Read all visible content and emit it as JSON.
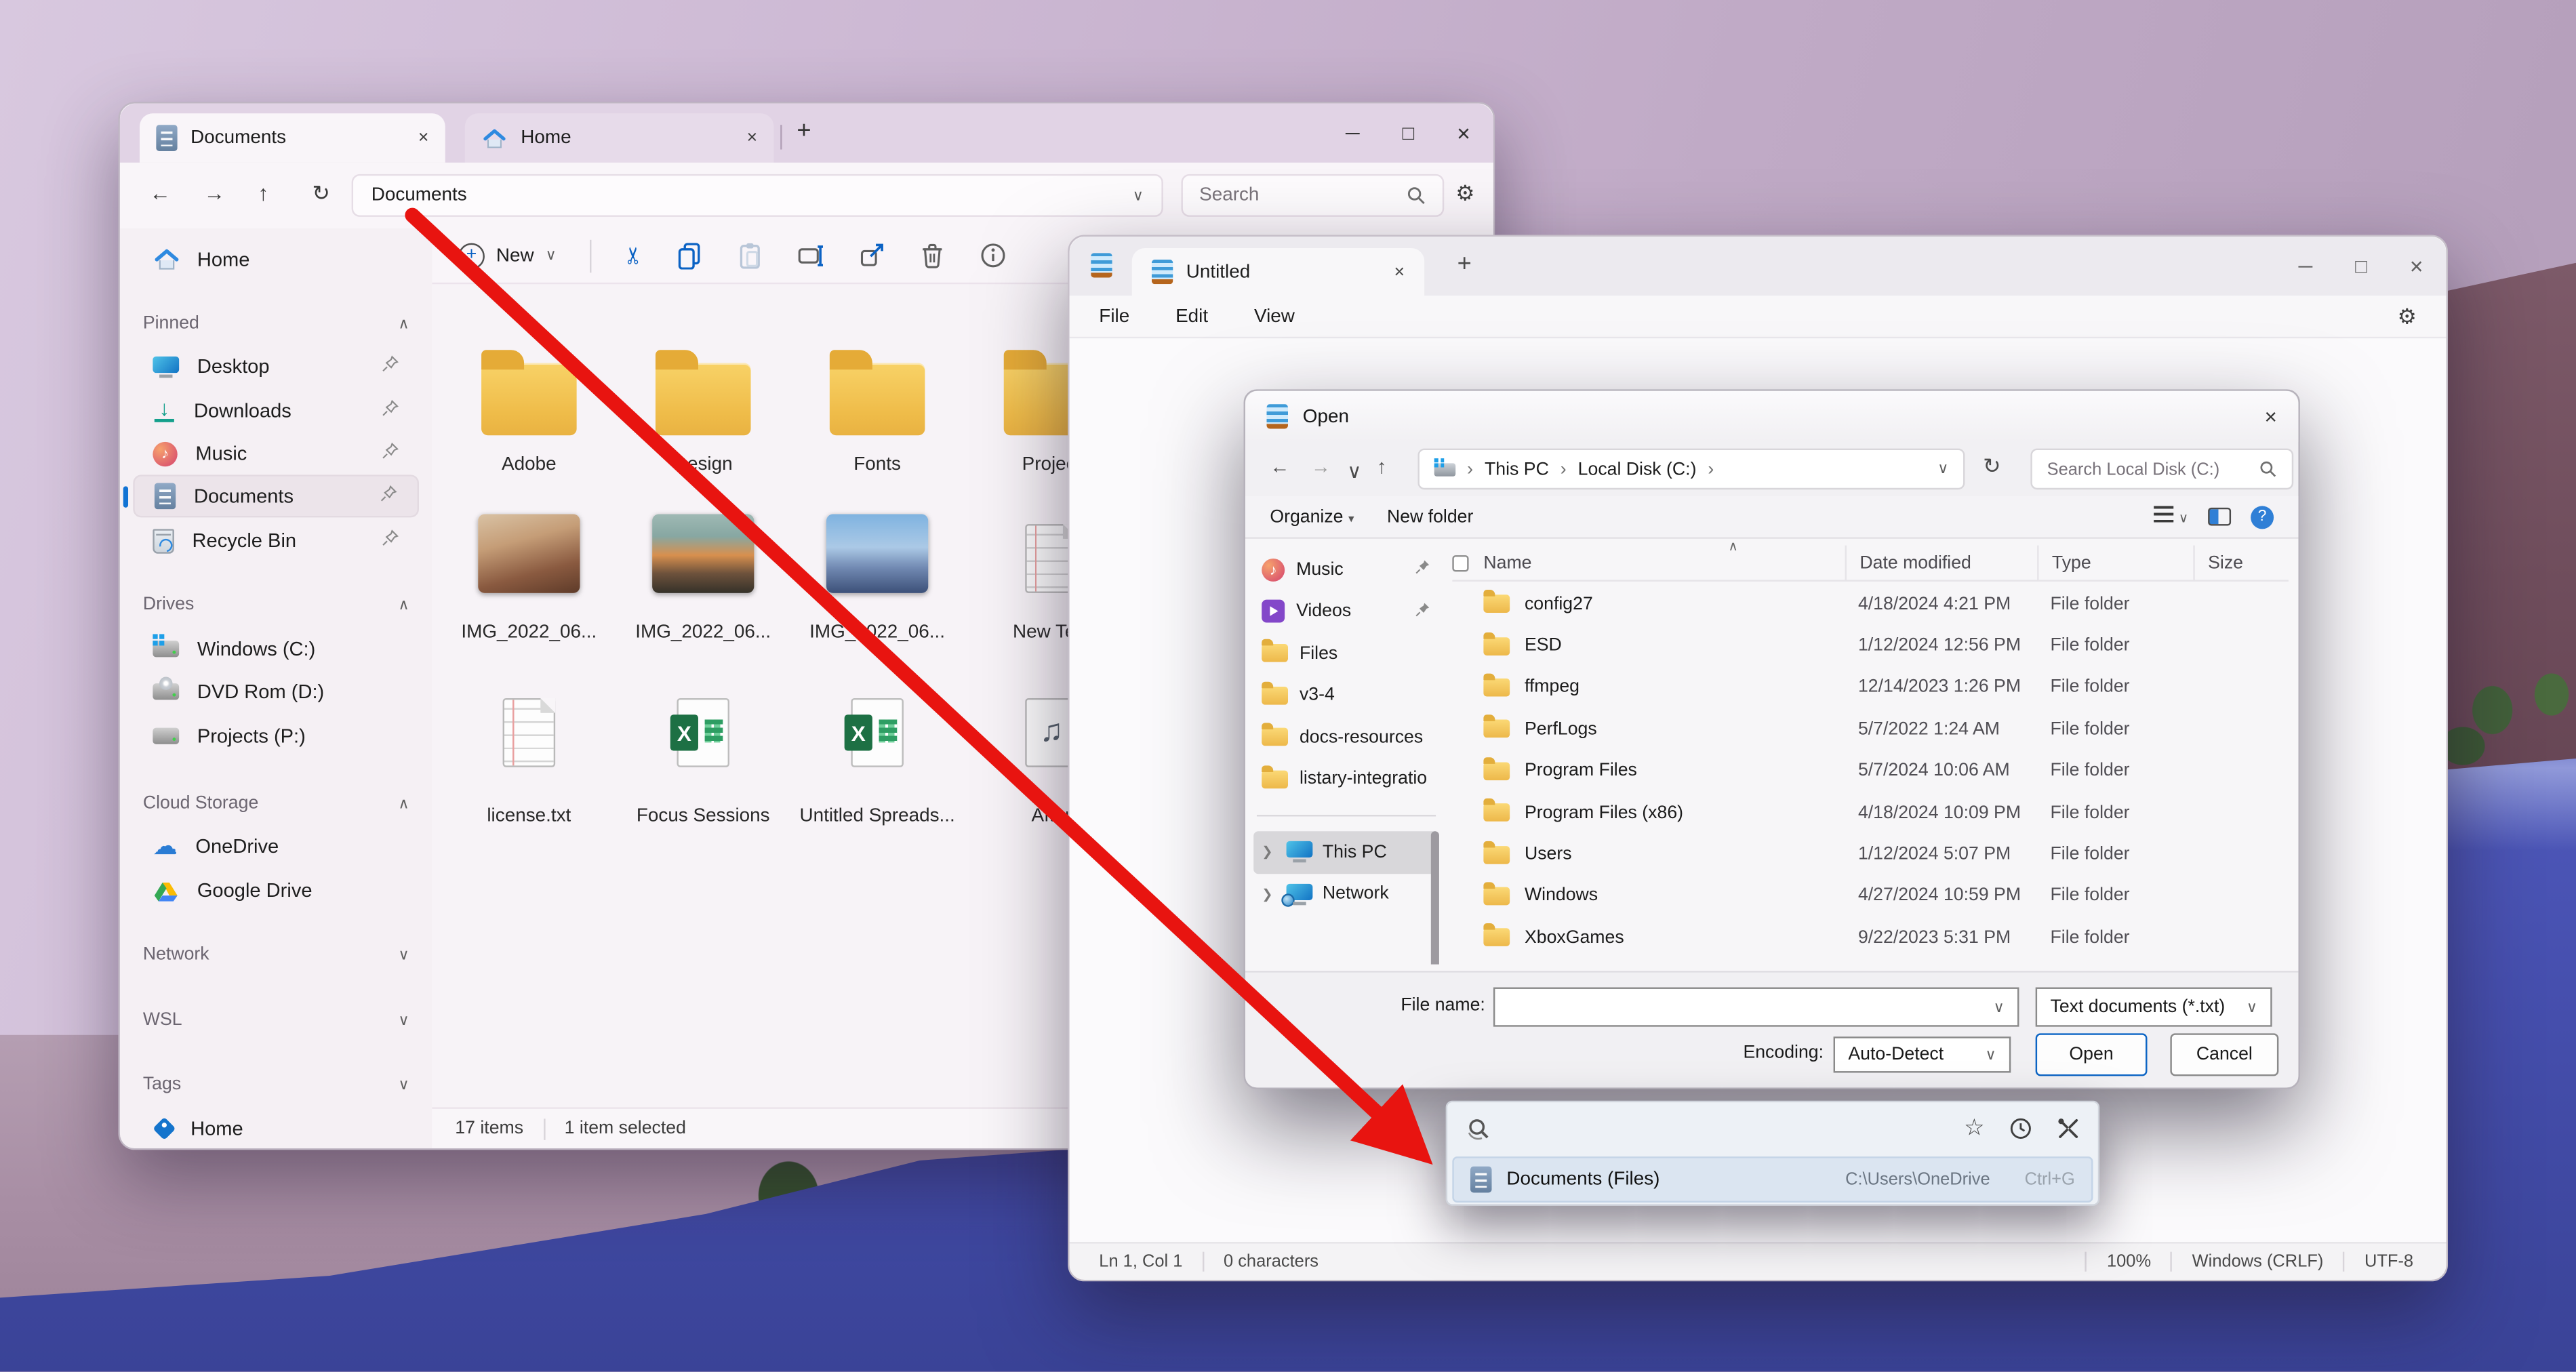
{
  "explorer": {
    "tabs": [
      {
        "label": "Documents"
      },
      {
        "label": "Home"
      }
    ],
    "address": "Documents",
    "search_placeholder": "Search",
    "toolbar": {
      "new_label": "New"
    },
    "sidebar": {
      "home": "Home",
      "pinned": {
        "label": "Pinned",
        "items": [
          "Desktop",
          "Downloads",
          "Music",
          "Documents",
          "Recycle Bin"
        ]
      },
      "drives": {
        "label": "Drives",
        "items": [
          "Windows (C:)",
          "DVD Rom (D:)",
          "Projects (P:)"
        ]
      },
      "cloud": {
        "label": "Cloud Storage",
        "items": [
          "OneDrive",
          "Google Drive"
        ]
      },
      "network_label": "Network",
      "wsl_label": "WSL",
      "tags_label": "Tags",
      "tag_home": "Home"
    },
    "items": {
      "folders": [
        "Adobe",
        "Design",
        "Fonts",
        "Project"
      ],
      "images": [
        "IMG_2022_06...",
        "IMG_2022_06...",
        "IMG_2022_06..."
      ],
      "newtext": "New Text",
      "files": [
        "license.txt",
        "Focus Sessions",
        "Untitled Spreads...",
        "After"
      ]
    },
    "status": {
      "count": "17 items",
      "selected": "1 item selected"
    }
  },
  "notepad": {
    "tab": "Untitled",
    "menus": [
      "File",
      "Edit",
      "View"
    ],
    "status": {
      "position": "Ln 1, Col 1",
      "characters": "0 characters",
      "zoom": "100%",
      "line_ending": "Windows (CRLF)",
      "encoding": "UTF-8"
    }
  },
  "dialog": {
    "title": "Open",
    "breadcrumb": {
      "root": "This PC",
      "folder": "Local Disk (C:)"
    },
    "search_placeholder": "Search Local Disk (C:)",
    "toolbar": {
      "organize": "Organize",
      "new_folder": "New folder"
    },
    "sidebar": {
      "quick": [
        "Music",
        "Videos",
        "Files",
        "v3-4",
        "docs-resources",
        "listary-integratio"
      ],
      "this_pc": "This PC",
      "network": "Network"
    },
    "columns": {
      "name": "Name",
      "date": "Date modified",
      "type": "Type",
      "size": "Size"
    },
    "rows": [
      {
        "name": "config27",
        "date": "4/18/2024 4:21 PM",
        "type": "File folder"
      },
      {
        "name": "ESD",
        "date": "1/12/2024 12:56 PM",
        "type": "File folder"
      },
      {
        "name": "ffmpeg",
        "date": "12/14/2023 1:26 PM",
        "type": "File folder"
      },
      {
        "name": "PerfLogs",
        "date": "5/7/2022 1:24 AM",
        "type": "File folder"
      },
      {
        "name": "Program Files",
        "date": "5/7/2024 10:06 AM",
        "type": "File folder"
      },
      {
        "name": "Program Files (x86)",
        "date": "4/18/2024 10:09 PM",
        "type": "File folder"
      },
      {
        "name": "Users",
        "date": "1/12/2024 5:07 PM",
        "type": "File folder"
      },
      {
        "name": "Windows",
        "date": "4/27/2024 10:59 PM",
        "type": "File folder"
      },
      {
        "name": "XboxGames",
        "date": "9/22/2023 5:31 PM",
        "type": "File folder"
      }
    ],
    "footer": {
      "file_name_label": "File name:",
      "file_type": "Text documents (*.txt)",
      "encoding_label": "Encoding:",
      "encoding": "Auto-Detect",
      "open": "Open",
      "cancel": "Cancel"
    }
  },
  "palette": {
    "result": {
      "label": "Documents (Files)",
      "path": "C:\\Users\\OneDrive",
      "shortcut": "Ctrl+G"
    }
  },
  "icons": {
    "search": "magnifier",
    "settings": "gear",
    "palette_favorites": "star",
    "palette_history": "clock",
    "palette_tools": "wrench"
  },
  "colors": {
    "accent": "#0b64c4",
    "arrow": "#e81410",
    "selection": "#dbe5f1",
    "titlebar": "#e1d3e5"
  }
}
